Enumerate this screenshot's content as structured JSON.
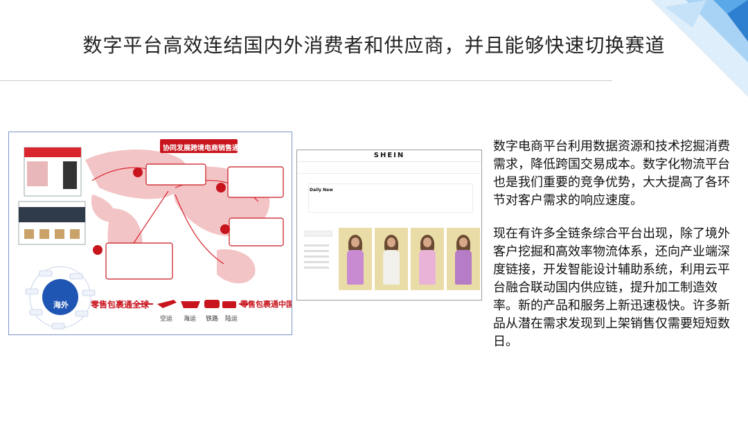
{
  "slide": {
    "title": "数字平台高效连结国内外消费者和供应商，并且能够快速切换赛道",
    "paragraph1": "数字电商平台利用数据资源和技术挖掘消费需求，降低跨国交易成本。数字化物流平台也是我们重要的竞争优势，大大提高了各环节对客户需求的响应速度。",
    "paragraph2": "现在有许多全链条综合平台出现，除了境外客户挖掘和高效率物流体系，还向产业端深度链接，开发智能设计辅助系统，利用云平台融合联动国内供应链，提升加工制造效率。新的产品和服务上新迅速极快。许多新品从潜在需求发现到上架销售仅需要短短数日。"
  },
  "figure_left": {
    "banner": "协同发展跨境电商销售通路",
    "hub": "海外",
    "left_slogan": "零售包裹通全球",
    "right_slogan": "零售包裹通中国",
    "transport": [
      "空运",
      "海运",
      "铁路",
      "陆运"
    ]
  },
  "figure_right": {
    "brand": "SHEIN",
    "section": "Daily New"
  },
  "colors": {
    "accent_red": "#c8141c",
    "map_pink": "#f3c4c6",
    "corner_blue": "#5aa8e8"
  }
}
